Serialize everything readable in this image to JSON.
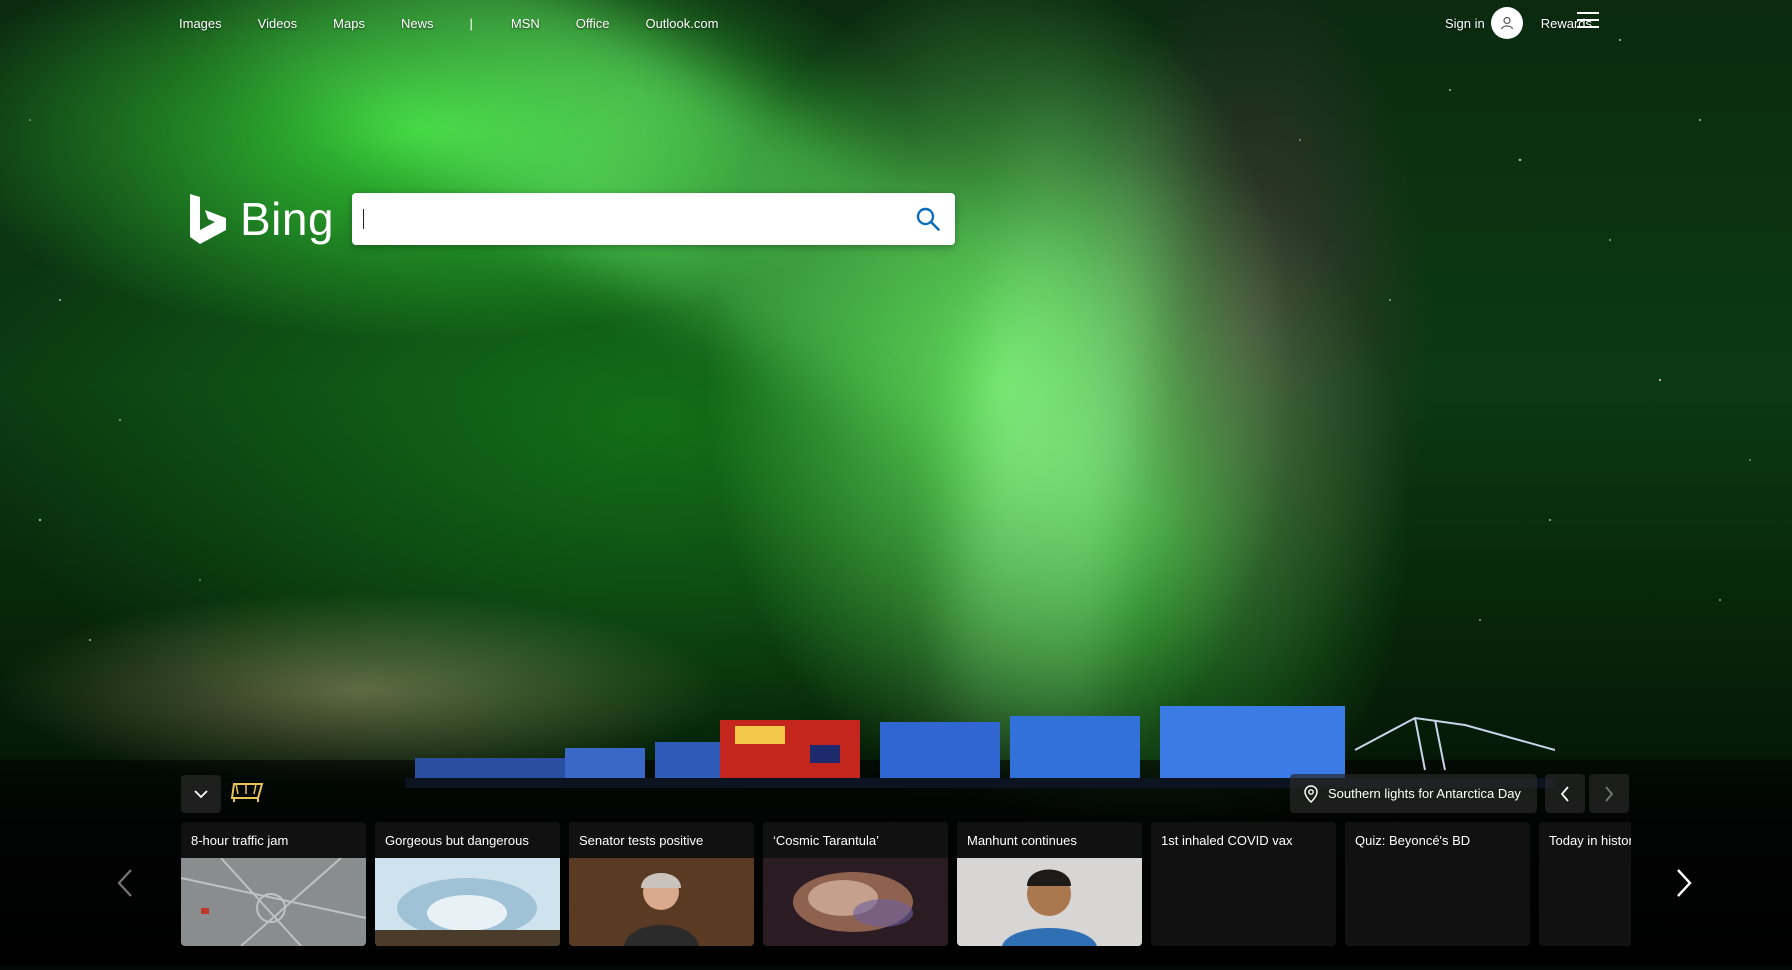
{
  "nav": {
    "items": [
      "Images",
      "Videos",
      "Maps",
      "News"
    ],
    "separator": "|",
    "items2": [
      "MSN",
      "Office",
      "Outlook.com"
    ]
  },
  "account": {
    "signin_label": "Sign in",
    "rewards_label": "Rewards"
  },
  "logo": {
    "text": "Bing"
  },
  "search": {
    "value": "",
    "placeholder": ""
  },
  "image_caption": {
    "text": "Southern lights for Antarctica Day"
  },
  "cards": [
    {
      "title": "8-hour traffic jam",
      "thumb": "aerial-roads"
    },
    {
      "title": "Gorgeous but dangerous",
      "thumb": "ice-cave"
    },
    {
      "title": "Senator tests positive",
      "thumb": "person-portrait"
    },
    {
      "title": "‘Cosmic Tarantula’",
      "thumb": "nebula"
    },
    {
      "title": "Manhunt continues",
      "thumb": "person-portrait"
    },
    {
      "title": "1st inhaled COVID vax",
      "thumb": "none"
    },
    {
      "title": "Quiz: Beyoncé's BD",
      "thumb": "none"
    },
    {
      "title": "Today in histor",
      "thumb": "none"
    }
  ],
  "icons": {
    "search": "search-icon",
    "avatar": "user-icon",
    "menu": "hamburger-icon",
    "collapse": "chevron-down-icon",
    "desktop": "bench-icon",
    "location": "location-pin-icon"
  },
  "colors": {
    "search_icon": "#0a6ebd",
    "card_bg": "#141414"
  }
}
